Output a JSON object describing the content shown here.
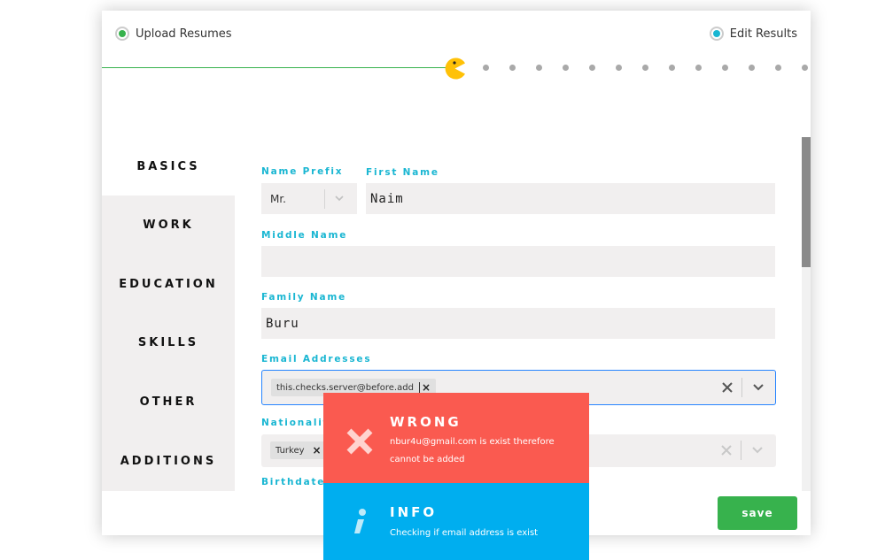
{
  "steps": {
    "upload": {
      "label": "Upload Resumes",
      "color": "#37b24d"
    },
    "edit": {
      "label": "Edit Results",
      "color": "#19b6d2"
    }
  },
  "sidebar": {
    "items": [
      {
        "label": "BASICS",
        "active": true
      },
      {
        "label": "WORK"
      },
      {
        "label": "EDUCATION"
      },
      {
        "label": "SKILLS"
      },
      {
        "label": "OTHER"
      },
      {
        "label": "ADDITIONS"
      }
    ]
  },
  "form": {
    "name_prefix": {
      "label": "Name Prefix",
      "value": "Mr."
    },
    "first_name": {
      "label": "First Name",
      "value": "Naim"
    },
    "middle_name": {
      "label": "Middle Name",
      "value": ""
    },
    "family_name": {
      "label": "Family Name",
      "value": "Buru"
    },
    "email_addresses": {
      "label": "Email Addresses",
      "chips": [
        "this.checks.server@before.add"
      ]
    },
    "nationality": {
      "label": "Nationalit",
      "chips": [
        "Turkey"
      ]
    },
    "birthdate": {
      "label": "Birthdate"
    }
  },
  "footer": {
    "save_label": "save"
  },
  "toasts": {
    "error": {
      "title": "WRONG",
      "message": "nbur4u@gmail.com is exist therefore cannot be added",
      "color": "#fa5a50"
    },
    "info": {
      "title": "INFO",
      "message": "Checking if email address is exist",
      "color": "#00aeef"
    }
  },
  "colors": {
    "accent": "#19b6d2",
    "success": "#37b24d",
    "pacman": "#ffc107"
  }
}
